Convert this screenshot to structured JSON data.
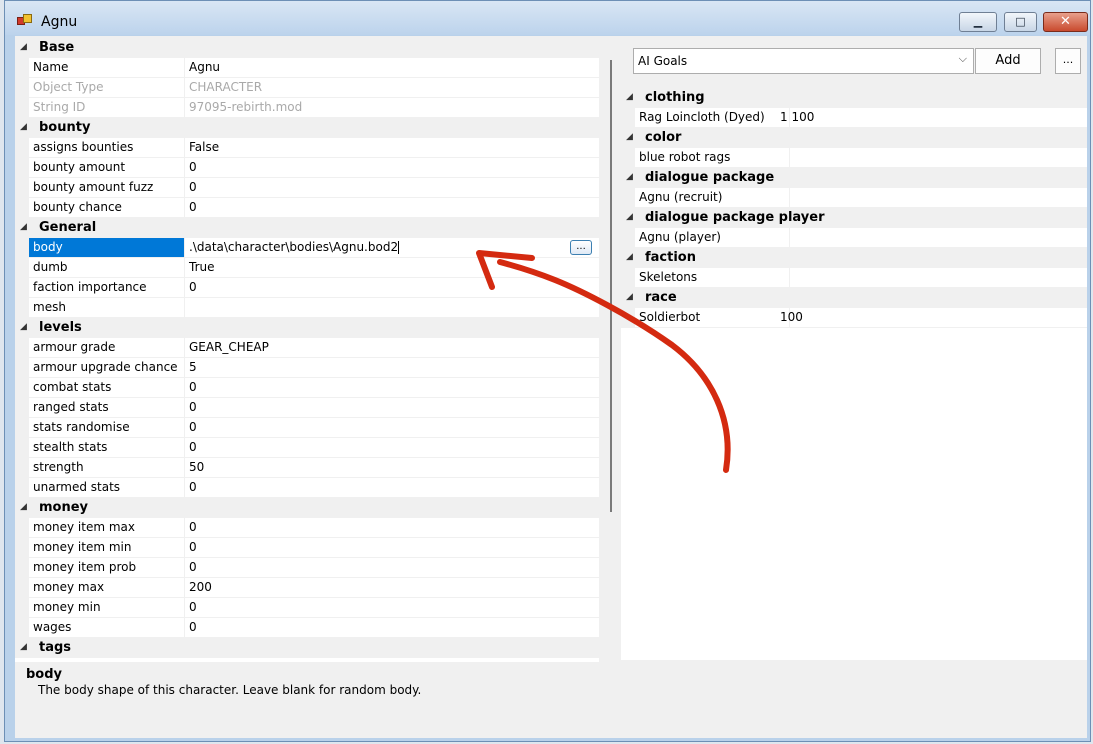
{
  "window": {
    "title": "Agnu",
    "minimize_glyph": "▁",
    "maximize_glyph": "□",
    "close_glyph": "✕"
  },
  "left_grid": {
    "sections": [
      {
        "name": "Base",
        "rows": [
          {
            "name": "Name",
            "value": "Agnu"
          },
          {
            "name": "Object Type",
            "value": "CHARACTER",
            "readonly": true
          },
          {
            "name": "String ID",
            "value": "97095-rebirth.mod",
            "readonly": true
          }
        ]
      },
      {
        "name": "bounty",
        "rows": [
          {
            "name": "assigns bounties",
            "value": "False"
          },
          {
            "name": "bounty amount",
            "value": "0"
          },
          {
            "name": "bounty amount fuzz",
            "value": "0"
          },
          {
            "name": "bounty chance",
            "value": "0"
          }
        ]
      },
      {
        "name": "General",
        "rows": [
          {
            "name": "body",
            "value": ".\\data\\character\\bodies\\Agnu.bod2",
            "selected": true
          },
          {
            "name": "dumb",
            "value": "True"
          },
          {
            "name": "faction importance",
            "value": "0"
          },
          {
            "name": "mesh",
            "value": ""
          }
        ]
      },
      {
        "name": "levels",
        "rows": [
          {
            "name": "armour grade",
            "value": "GEAR_CHEAP"
          },
          {
            "name": "armour upgrade chance",
            "value": "5"
          },
          {
            "name": "combat stats",
            "value": "0"
          },
          {
            "name": "ranged stats",
            "value": "0"
          },
          {
            "name": "stats randomise",
            "value": "0"
          },
          {
            "name": "stealth stats",
            "value": "0"
          },
          {
            "name": "strength",
            "value": "50"
          },
          {
            "name": "unarmed stats",
            "value": "0"
          }
        ]
      },
      {
        "name": "money",
        "rows": [
          {
            "name": "money item max",
            "value": "0"
          },
          {
            "name": "money item min",
            "value": "0"
          },
          {
            "name": "money item prob",
            "value": "0"
          },
          {
            "name": "money max",
            "value": "200"
          },
          {
            "name": "money min",
            "value": "0"
          },
          {
            "name": "wages",
            "value": "0"
          }
        ]
      },
      {
        "name": "tags",
        "rows": []
      }
    ],
    "browse_label": "..."
  },
  "help": {
    "title": "body",
    "description": "The body shape of this character.  Leave blank for random body."
  },
  "right_panel": {
    "dropdown": {
      "value": "AI Goals",
      "arrow": "⌵"
    },
    "add_label": "Add",
    "more_label": "...",
    "sections": [
      {
        "name": "clothing",
        "rows": [
          {
            "name": "Rag Loincloth (Dyed)",
            "value": "1     100"
          }
        ]
      },
      {
        "name": "color",
        "rows": [
          {
            "name": "blue robot rags",
            "value": ""
          }
        ]
      },
      {
        "name": "dialogue package",
        "rows": [
          {
            "name": "Agnu (recruit)",
            "value": ""
          }
        ]
      },
      {
        "name": "dialogue package player",
        "rows": [
          {
            "name": "Agnu (player)",
            "value": ""
          }
        ]
      },
      {
        "name": "faction",
        "rows": [
          {
            "name": "Skeletons",
            "value": ""
          }
        ]
      },
      {
        "name": "race",
        "rows": [
          {
            "name": "Soldierbot",
            "value": "100"
          }
        ]
      }
    ]
  },
  "annotation": {
    "color": "#d42a10"
  },
  "icons": {
    "collapse": "◢"
  }
}
